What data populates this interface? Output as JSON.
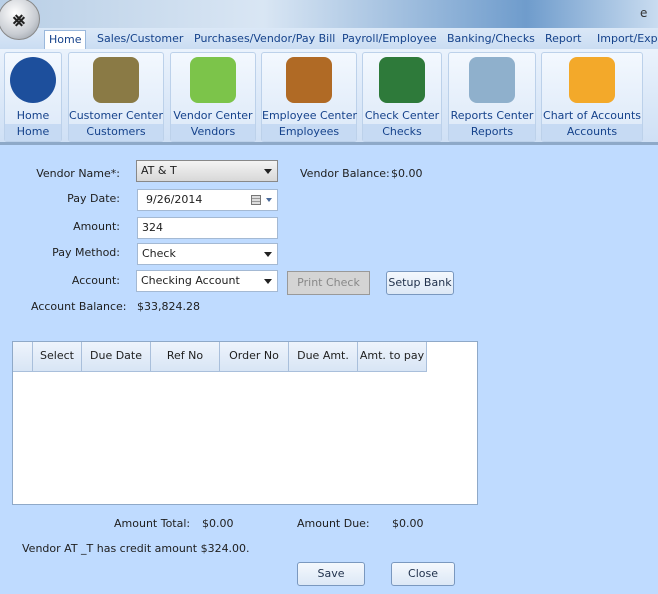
{
  "window": {
    "title_fragment": "e"
  },
  "tabs": [
    "Home",
    "Sales/Customer",
    "Purchases/Vendor/Pay Bill",
    "Payroll/Employee",
    "Banking/Checks",
    "Report",
    "Import/Expo"
  ],
  "ribbon": [
    {
      "label": "Home",
      "group": "Home",
      "icon": "home-icon",
      "color": "#1d4f9c"
    },
    {
      "label": "Customer Center",
      "group": "Customers",
      "icon": "customer-folder-icon",
      "color": "#8a7a45"
    },
    {
      "label": "Vendor Center",
      "group": "Vendors",
      "icon": "vendor-book-icon",
      "color": "#7cc44a"
    },
    {
      "label": "Employee Center",
      "group": "Employees",
      "icon": "employee-group-icon",
      "color": "#b06a25"
    },
    {
      "label": "Check Center",
      "group": "Checks",
      "icon": "checkbook-icon",
      "color": "#2e7a3a"
    },
    {
      "label": "Reports Center",
      "group": "Reports",
      "icon": "reports-binder-icon",
      "color": "#8fb0cc"
    },
    {
      "label": "Chart of Accounts",
      "group": "Accounts",
      "icon": "accounts-folder-icon",
      "color": "#f3a92a"
    }
  ],
  "form": {
    "vendor_name_label": "Vendor Name*:",
    "vendor_name": "AT & T",
    "vendor_balance_label": "Vendor Balance:",
    "vendor_balance": "$0.00",
    "pay_date_label": "Pay Date:",
    "pay_date": "9/26/2014",
    "amount_label": "Amount:",
    "amount": "324",
    "pay_method_label": "Pay Method:",
    "pay_method": "Check",
    "account_label": "Account:",
    "account": "Checking Account",
    "print_check": "Print Check",
    "setup_bank": "Setup Bank",
    "account_balance_label": "Account Balance:",
    "account_balance": "$33,824.28"
  },
  "grid": {
    "columns": [
      "Select",
      "Due Date",
      "Ref No",
      "Order No",
      "Due Amt.",
      "Amt. to pay"
    ],
    "rows": []
  },
  "totals": {
    "amount_total_label": "Amount Total:",
    "amount_total": "$0.00",
    "amount_due_label": "Amount Due:",
    "amount_due": "$0.00"
  },
  "message": "Vendor AT _T has credit amount $324.00.",
  "buttons": {
    "save": "Save",
    "close": "Close"
  }
}
